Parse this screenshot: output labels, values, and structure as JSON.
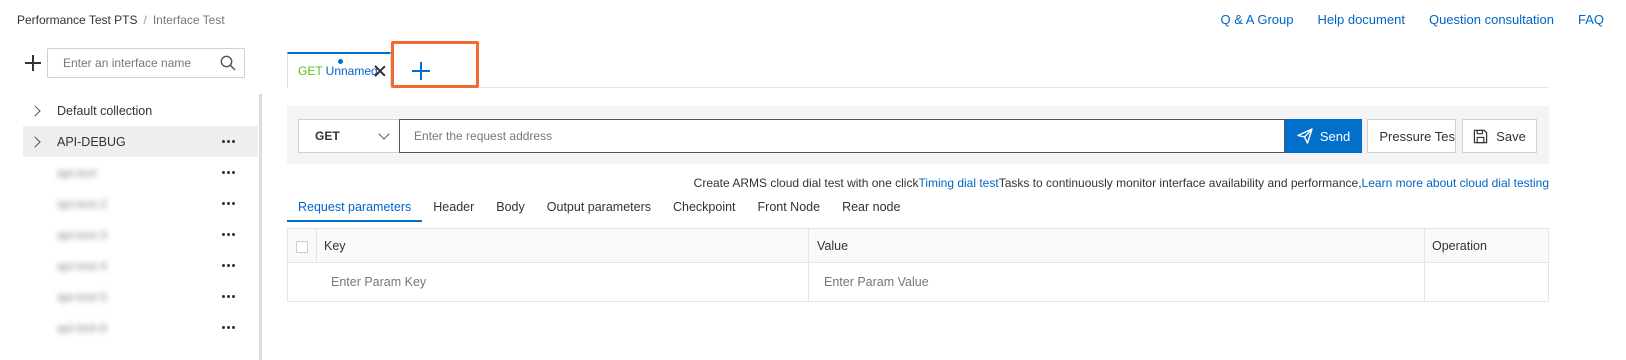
{
  "breadcrumb": {
    "product": "Performance Test PTS",
    "separator": "/",
    "current": "Interface Test"
  },
  "top_links": [
    "Q & A Group",
    "Help document",
    "Question consultation",
    "FAQ"
  ],
  "sidebar": {
    "search_placeholder": "Enter an interface name",
    "items": [
      {
        "label": "Default collection",
        "expandable": true,
        "selected": false
      },
      {
        "label": "API-DEBUG",
        "expandable": true,
        "selected": true
      },
      {
        "label": "api-test",
        "blurred": true
      },
      {
        "label": "api-test-2",
        "blurred": true
      },
      {
        "label": "api-test-3",
        "blurred": true
      },
      {
        "label": "api-test-4",
        "blurred": true
      },
      {
        "label": "api-test-5",
        "blurred": true
      },
      {
        "label": "api-test-6",
        "blurred": true
      }
    ]
  },
  "tabs": {
    "active": {
      "method": "GET",
      "name": "Unnamed"
    }
  },
  "request": {
    "method": "GET",
    "url_placeholder": "Enter the request address",
    "send_label": "Send",
    "pressure_label": "Pressure Tes",
    "save_label": "Save"
  },
  "notice": {
    "prefix": "Create ARMS cloud dial test with one click",
    "link1": "Timing dial test",
    "middle": "Tasks to continuously monitor interface availability and performance,",
    "link2": "Learn more about cloud dial testing"
  },
  "subtabs": [
    "Request parameters",
    "Header",
    "Body",
    "Output parameters",
    "Checkpoint",
    "Front Node",
    "Rear node"
  ],
  "params_table": {
    "columns": [
      "Key",
      "Value",
      "Operation"
    ],
    "key_placeholder": "Enter Param Key",
    "value_placeholder": "Enter Param Value"
  },
  "colors": {
    "accent": "#0070cc",
    "link": "#0064c8",
    "highlight_border": "#f26b2d",
    "method_get": "#52c41a"
  }
}
